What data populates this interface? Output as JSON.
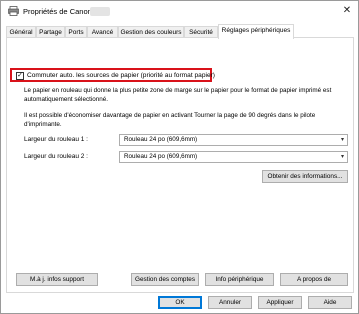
{
  "window": {
    "title": "Propriétés de Canon",
    "close_glyph": "✕"
  },
  "tabs": [
    {
      "label": "Général"
    },
    {
      "label": "Partage"
    },
    {
      "label": "Ports"
    },
    {
      "label": "Avancé"
    },
    {
      "label": "Gestion des couleurs"
    },
    {
      "label": "Sécurité"
    },
    {
      "label": "Réglages périphériques",
      "active": true
    }
  ],
  "panel": {
    "auto_switch": {
      "checked": true,
      "check_glyph": "✓",
      "label": "Commuter auto. les sources de papier (priorité au format papier)"
    },
    "description_1": "Le papier en rouleau qui donne la plus petite zone de marge sur le papier pour le format de papier imprimé est automatiquement sélectionné.",
    "description_2": "Il est possible d'économiser davantage de papier en activant Tourner la page de 90 degrés dans le pilote d'imprimante.",
    "roll1": {
      "label": "Largeur du rouleau 1 :",
      "value": "Rouleau 24 po (609,6mm)"
    },
    "roll2": {
      "label": "Largeur du rouleau 2 :",
      "value": "Rouleau 24 po (609,6mm)"
    },
    "get_info_button": "Obtenir des informations...",
    "bottom_buttons": {
      "update_support": "M.à j. infos support",
      "account_management": "Gestion des comptes",
      "device_info": "Info périphérique",
      "about": "A propos de"
    }
  },
  "dialog_buttons": {
    "ok": "OK",
    "cancel": "Annuler",
    "apply": "Appliquer",
    "help": "Aide"
  },
  "colors": {
    "highlight_border": "#d9121a",
    "primary_button_border": "#0078d7"
  }
}
